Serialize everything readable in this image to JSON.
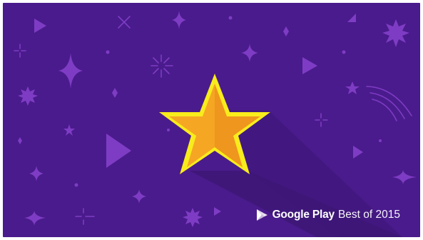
{
  "banner": {
    "brand_name": "Google Play",
    "brand_tagline": "Best of 2015",
    "logo_icon": "google-play-logo-icon",
    "background_color": "#4a1b8c",
    "decoration_color": "#7e3cc4",
    "star_color": "#f5a623",
    "star_outline_color": "#f8ec1c",
    "shadow_color": "#3a1472"
  }
}
